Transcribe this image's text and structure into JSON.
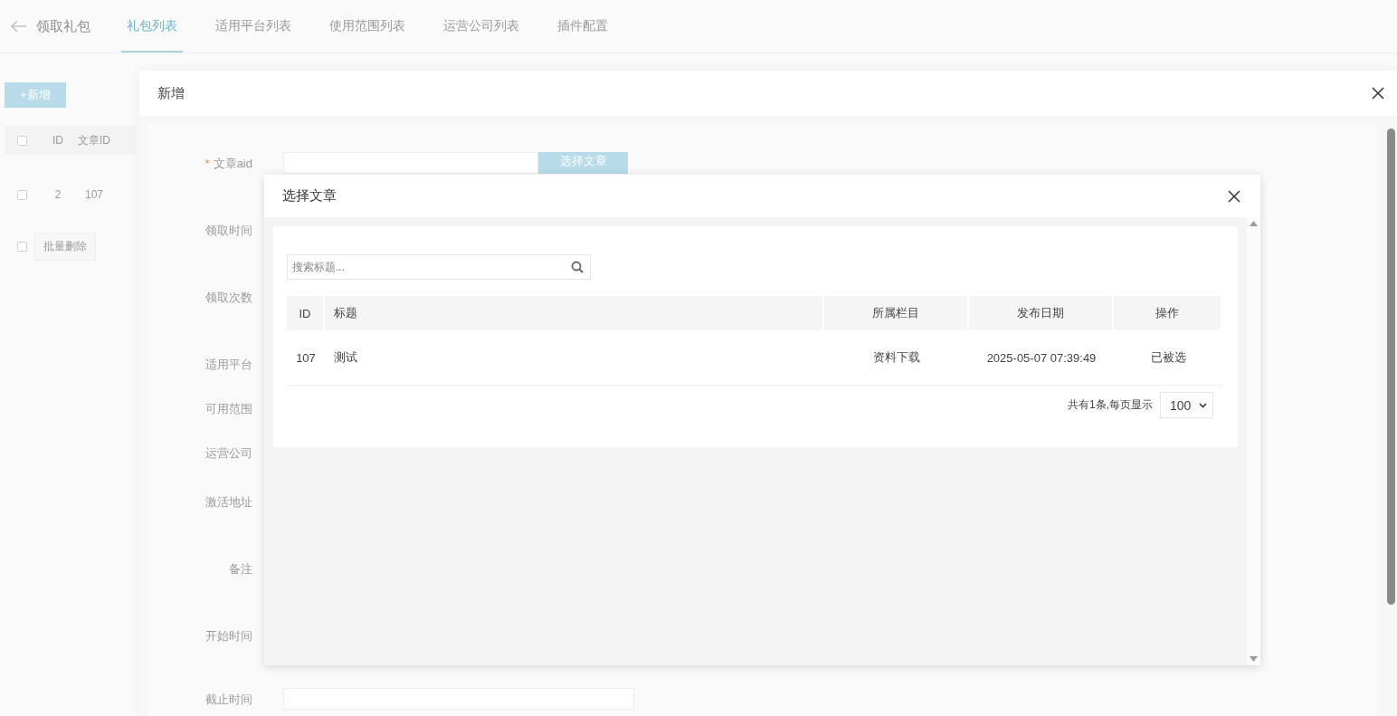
{
  "page": {
    "back_title": "领取礼包",
    "tabs": [
      {
        "label": "礼包列表",
        "selected": true
      },
      {
        "label": "适用平台列表",
        "selected": false
      },
      {
        "label": "使用范围列表",
        "selected": false
      },
      {
        "label": "运营公司列表",
        "selected": false
      },
      {
        "label": "插件配置",
        "selected": false
      }
    ]
  },
  "list": {
    "add_button": "+新增",
    "header_checked": false,
    "columns": [
      "ID",
      "文章ID"
    ],
    "rows": [
      {
        "checked": false,
        "cells": [
          "2",
          "107"
        ]
      }
    ],
    "batch": {
      "checked": false,
      "button": "批量删除"
    }
  },
  "add_dialog": {
    "title": "新增",
    "fields": [
      {
        "label": "文章aid",
        "required_mark": "*",
        "kind": "picker",
        "button": "选择文章"
      },
      {
        "label": "领取时间",
        "kind": "hidden"
      },
      {
        "label": "领取次数",
        "kind": "hidden"
      },
      {
        "label": "适用平台",
        "kind": "hidden"
      },
      {
        "label": "可用范围",
        "kind": "hidden"
      },
      {
        "label": "运营公司",
        "kind": "hidden"
      },
      {
        "label": "激活地址",
        "kind": "hidden"
      },
      {
        "label": "备注",
        "kind": "hidden"
      },
      {
        "label": "开始时间",
        "kind": "hidden"
      },
      {
        "label": "截止时间",
        "kind": "input"
      }
    ]
  },
  "select_dialog": {
    "title": "选择文章",
    "search": {
      "placeholder": "搜索标题..."
    },
    "columns": [
      "ID",
      "标题",
      "所属栏目",
      "发布日期",
      "操作"
    ],
    "rows": [
      {
        "cells": [
          "107",
          "测试",
          "资料下载",
          "2025-05-07 07:39:49",
          "已被选"
        ]
      }
    ],
    "pagination": {
      "summary": "共有1条,每页显示",
      "page_size": "100"
    }
  }
}
